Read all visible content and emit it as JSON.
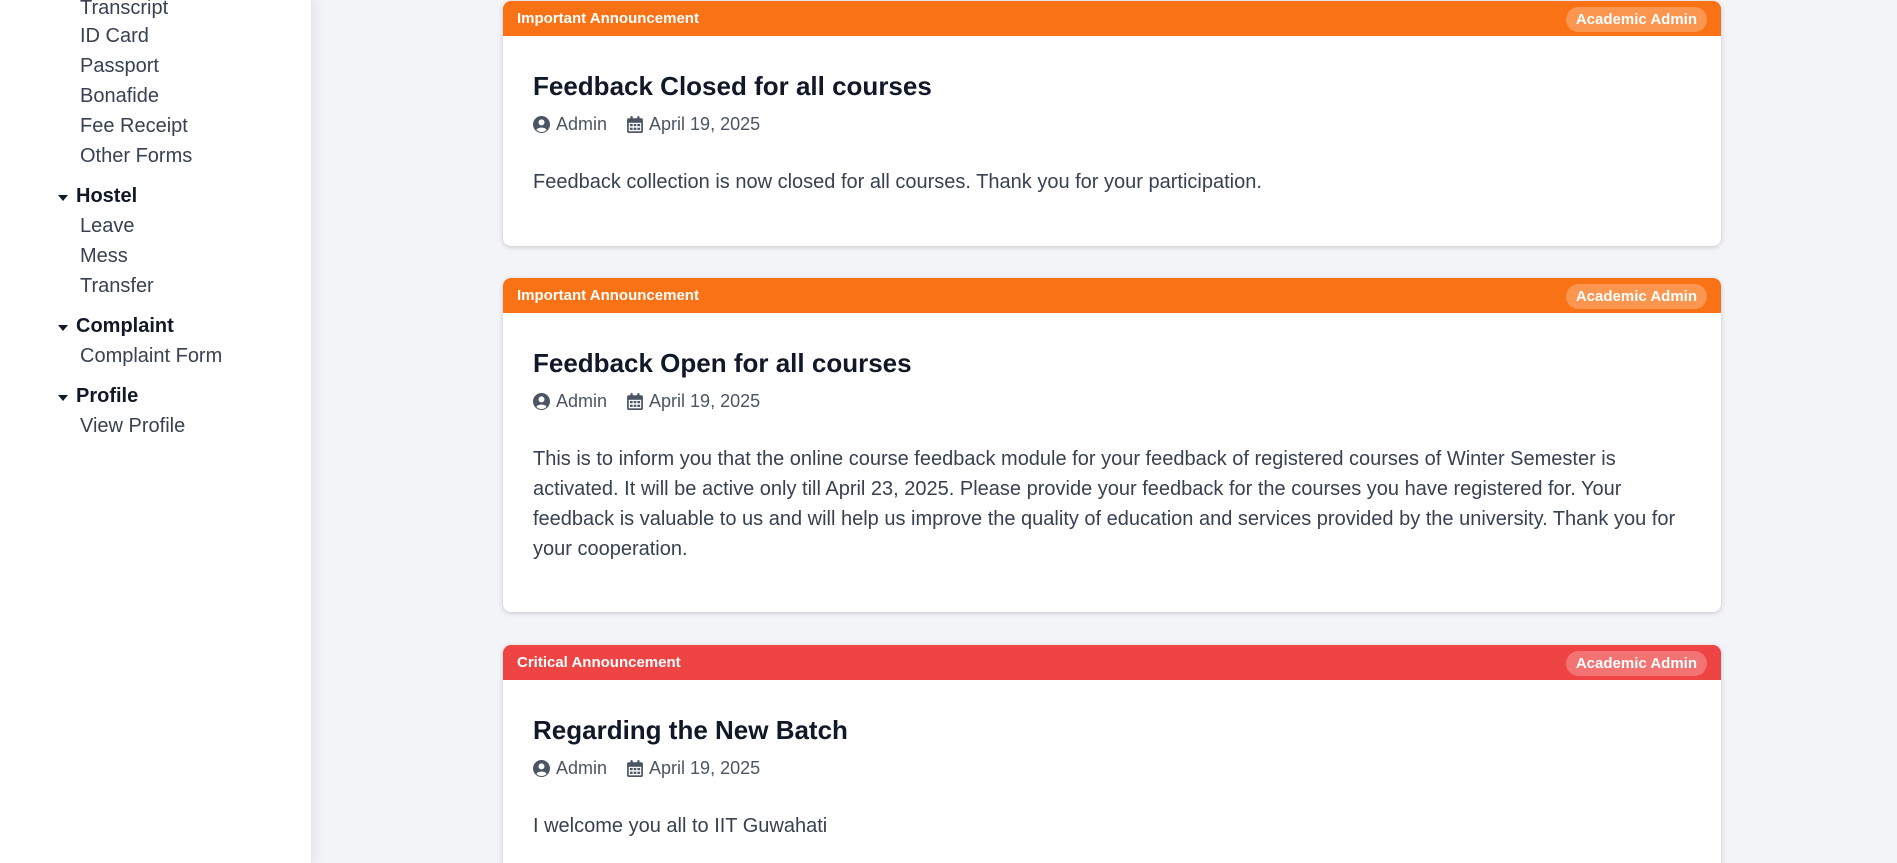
{
  "sidebar": {
    "forms": [
      "Transcript",
      "ID Card",
      "Passport",
      "Bonafide",
      "Fee Receipt",
      "Other Forms"
    ],
    "hostel": {
      "label": "Hostel",
      "items": [
        "Leave",
        "Mess",
        "Transfer"
      ]
    },
    "complaint": {
      "label": "Complaint",
      "items": [
        "Complaint Form"
      ]
    },
    "profile": {
      "label": "Profile",
      "items": [
        "View Profile"
      ]
    }
  },
  "colors": {
    "important": "#f97316",
    "critical": "#ef4444"
  },
  "announcements": [
    {
      "type": "Important Announcement",
      "badge": "Academic Admin",
      "title": "Feedback Closed for all courses",
      "author": "Admin",
      "date": "April 19, 2025",
      "body": "Feedback collection is now closed for all courses. Thank you for your participation."
    },
    {
      "type": "Important Announcement",
      "badge": "Academic Admin",
      "title": "Feedback Open for all courses",
      "author": "Admin",
      "date": "April 19, 2025",
      "body": "This is to inform you that the online course feedback module for your feedback of registered courses of Winter Semester is activated. It will be active only till April 23, 2025. Please provide your feedback for the courses you have registered for. Your feedback is valuable to us and will help us improve the quality of education and services provided by the university. Thank you for your cooperation."
    },
    {
      "type": "Critical Announcement",
      "badge": "Academic Admin",
      "title": "Regarding the New Batch",
      "author": "Admin",
      "date": "April 19, 2025",
      "body": "I welcome you all to IIT Guwahati"
    }
  ]
}
